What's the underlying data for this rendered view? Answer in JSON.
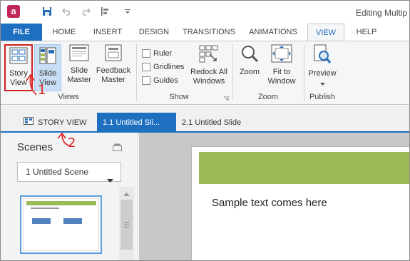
{
  "window": {
    "title": "Editing Multip"
  },
  "app_icon_letter": "a",
  "tabs": {
    "file": "FILE",
    "home": "HOME",
    "insert": "INSERT",
    "design": "DESIGN",
    "transitions": "TRANSITIONS",
    "animations": "ANIMATIONS",
    "view": "VIEW",
    "help": "HELP"
  },
  "ribbon": {
    "views": {
      "story_view": "Story View",
      "slide_view": "Slide View",
      "slide_master": "Slide Master",
      "feedback_master": "Feedback Master",
      "label": "Views"
    },
    "show": {
      "ruler": "Ruler",
      "gridlines": "Gridlines",
      "guides": "Guides",
      "redock_all_windows": "Redock All Windows",
      "label": "Show"
    },
    "zoom": {
      "zoom": "Zoom",
      "fit_to_window": "Fit to Window",
      "label": "Zoom"
    },
    "publish": {
      "preview": "Preview",
      "label": "Publish"
    }
  },
  "view_tabs": {
    "story_view": "STORY VIEW",
    "active_slide": "1.1 Untitled Sli...",
    "other_slide": "2.1 Untitled Slide"
  },
  "scenes": {
    "title": "Scenes",
    "selected_scene": "1 Untitled Scene"
  },
  "slide": {
    "body_text": "Sample text comes here"
  },
  "annotations": {
    "step1": "1",
    "step2": "2"
  },
  "colors": {
    "accent": "#1d6fbf",
    "banner": "#9bbb59",
    "annotation": "#e02020"
  }
}
